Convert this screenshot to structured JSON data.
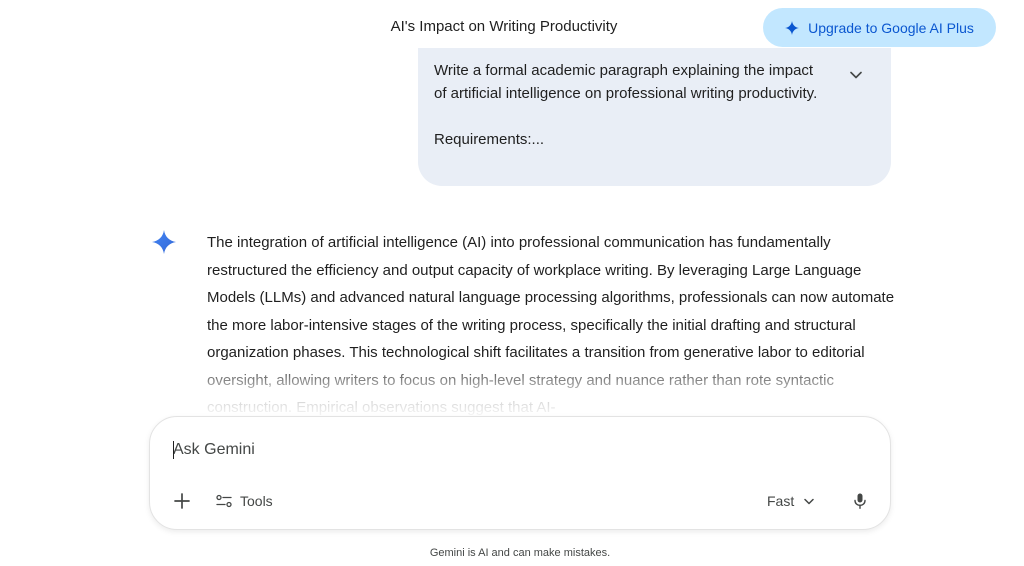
{
  "header": {
    "title": "AI's Impact on Writing Productivity",
    "upgrade_label": "Upgrade to Google AI Plus"
  },
  "prompt": {
    "lines": [
      "Write a formal academic paragraph explaining the impact of artificial intelligence on professional writing productivity.",
      "Requirements:..."
    ]
  },
  "response": {
    "text": "The integration of artificial intelligence (AI) into professional communication has fundamentally restructured the efficiency and output capacity of workplace writing. By leveraging Large Language Models (LLMs) and advanced natural language processing algorithms, professionals can now automate the more labor-intensive stages of the writing process, specifically the initial drafting and structural organization phases. This technological shift facilitates a transition from generative labor to editorial oversight, allowing writers to focus on high-level strategy and nuance rather than rote syntactic construction. Empirical observations suggest that AI-"
  },
  "composer": {
    "placeholder": "Ask Gemini",
    "tools_label": "Tools",
    "model_label": "Fast"
  },
  "footer": {
    "disclaimer": "Gemini is AI and can make mistakes."
  },
  "icons": {
    "spark": "gemini-spark-icon",
    "expand": "chevron-down-icon",
    "add": "plus-icon",
    "tools": "tools-icon",
    "model": "chevron-down-icon",
    "mic": "microphone-icon"
  },
  "colors": {
    "accent": "#0b57d0",
    "upgrade_bg": "#c2e7ff",
    "bubble_bg": "#e9eef6",
    "spark": "#4285f4"
  }
}
